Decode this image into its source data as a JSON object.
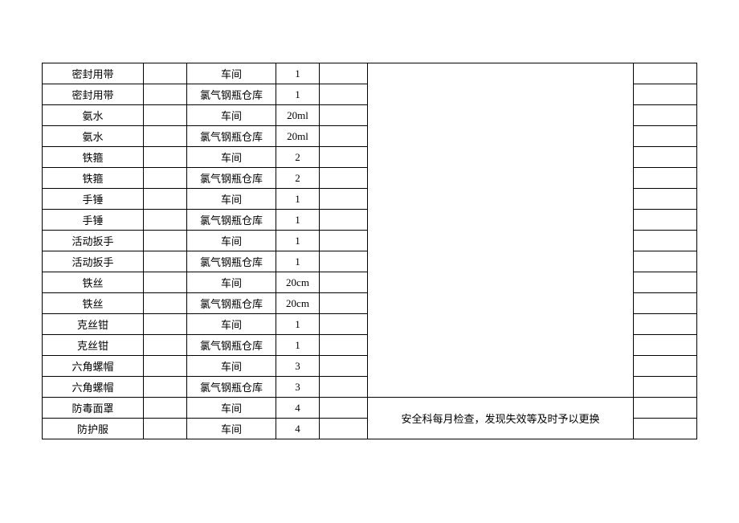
{
  "rows": [
    {
      "name": "密封用带",
      "loc": "车间",
      "qty": "1"
    },
    {
      "name": "密封用带",
      "loc": "氯气钢瓶仓库",
      "qty": "1"
    },
    {
      "name": "氨水",
      "loc": "车间",
      "qty": "20ml"
    },
    {
      "name": "氨水",
      "loc": "氯气钢瓶仓库",
      "qty": "20ml"
    },
    {
      "name": "铁箍",
      "loc": "车间",
      "qty": "2"
    },
    {
      "name": "铁箍",
      "loc": "氯气钢瓶仓库",
      "qty": "2"
    },
    {
      "name": "手锤",
      "loc": "车间",
      "qty": "1"
    },
    {
      "name": "手锤",
      "loc": "氯气钢瓶仓库",
      "qty": "1"
    },
    {
      "name": "活动扳手",
      "loc": "车间",
      "qty": "1"
    },
    {
      "name": "活动扳手",
      "loc": "氯气钢瓶仓库",
      "qty": "1"
    },
    {
      "name": "铁丝",
      "loc": "车间",
      "qty": "20cm"
    },
    {
      "name": "铁丝",
      "loc": "氯气钢瓶仓库",
      "qty": "20cm"
    },
    {
      "name": "克丝钳",
      "loc": "车间",
      "qty": "1"
    },
    {
      "name": "克丝钳",
      "loc": "氯气钢瓶仓库",
      "qty": "1"
    },
    {
      "name": "六角螺帽",
      "loc": "车间",
      "qty": "3"
    },
    {
      "name": "六角螺帽",
      "loc": "氯气钢瓶仓库",
      "qty": "3"
    }
  ],
  "last_rows": [
    {
      "name": "防毒面罩",
      "loc": "车间",
      "qty": "4"
    },
    {
      "name": "防护服",
      "loc": "车间",
      "qty": "4"
    }
  ],
  "note": "安全科每月检查，发现失效等及时予以更换"
}
